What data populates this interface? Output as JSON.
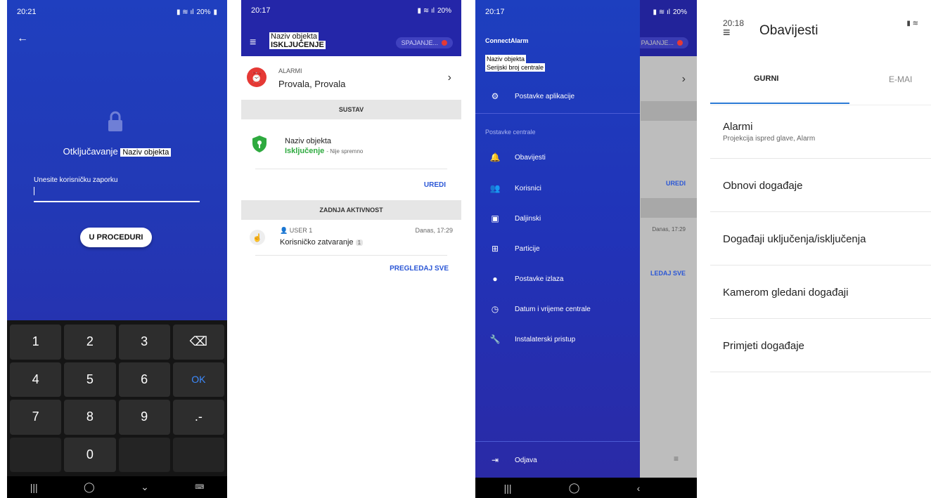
{
  "screen1": {
    "time": "20:21",
    "battery": "20%",
    "unlock_prefix": "Otključavanje",
    "object_name": "Naziv objekta",
    "password_label": "Unesite korisničku zaporku",
    "procedure_button": "U PROCEDURI",
    "keys": [
      "1",
      "2",
      "3",
      "⌫",
      "4",
      "5",
      "6",
      "OK",
      "7",
      "8",
      "9",
      ".-",
      "",
      "0",
      "",
      ""
    ]
  },
  "screen2": {
    "time": "20:17",
    "battery": "20%",
    "header_object": "Naziv objekta",
    "header_state": "ISKLJUČENJE",
    "connecting": "SPAJANJE...",
    "alarms_label": "ALARMI",
    "alarms_value": "Provala, Provala",
    "system_section": "SUSTAV",
    "system_name": "Naziv objekta",
    "system_state": "Isključenje",
    "system_ready": "- Nije spremno",
    "edit_button": "UREDI",
    "activity_section": "ZADNJA AKTIVNOST",
    "activity_user": "USER 1",
    "activity_date": "Danas, 17:29",
    "activity_text": "Korisničko zatvaranje",
    "activity_count": "1",
    "view_all": "PREGLEDAJ SVE"
  },
  "screen3": {
    "time": "20:17",
    "battery": "20%",
    "app_name": "ConnectAlarm",
    "object_name": "Naziv objekta",
    "serial": "Serijski broj centrale",
    "app_settings": "Postavke aplikacije",
    "central_settings_header": "Postavke centrale",
    "menu": [
      "Obavijesti",
      "Korisnici",
      "Daljinski",
      "Particije",
      "Postavke izlaza",
      "Datum i vrijeme centrale",
      "Instalaterski pristup"
    ],
    "logout": "Odjava",
    "bg_connecting": "PAJANJE...",
    "bg_edit": "UREDI",
    "bg_date": "Danas, 17:29",
    "bg_view_all": "LEDAJ SVE"
  },
  "screen4": {
    "time": "20:18",
    "title": "Obavijesti",
    "tab_push": "GURNI",
    "tab_email": "E-MAI",
    "items": [
      {
        "title": "Alarmi",
        "subtitle": "Projekcija ispred glave, Alarm"
      },
      {
        "title": "Obnovi događaje",
        "subtitle": ""
      },
      {
        "title": "Događaji uključenja/isključenja",
        "subtitle": ""
      },
      {
        "title": "Kamerom gledani događaji",
        "subtitle": ""
      },
      {
        "title": "Primjeti događaje",
        "subtitle": ""
      }
    ]
  },
  "colors": {
    "primary": "#2426a8",
    "accent": "#2b57d6",
    "alarm": "#e53935",
    "ok_green": "#2eaa3f"
  }
}
